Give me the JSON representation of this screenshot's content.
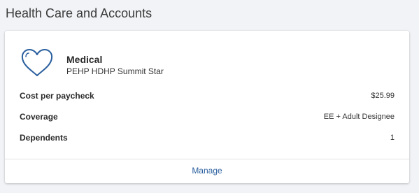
{
  "section": {
    "title": "Health Care and Accounts"
  },
  "plan": {
    "icon": "heart-icon",
    "name": "Medical",
    "subtitle": "PEHP HDHP Summit Star",
    "rows": [
      {
        "label": "Cost per paycheck",
        "value": "$25.99"
      },
      {
        "label": "Coverage",
        "value": "EE + Adult Designee"
      },
      {
        "label": "Dependents",
        "value": "1"
      }
    ],
    "manage_label": "Manage"
  },
  "colors": {
    "accent": "#2a5f9e",
    "background": "#f1f3f6",
    "card": "#ffffff"
  }
}
